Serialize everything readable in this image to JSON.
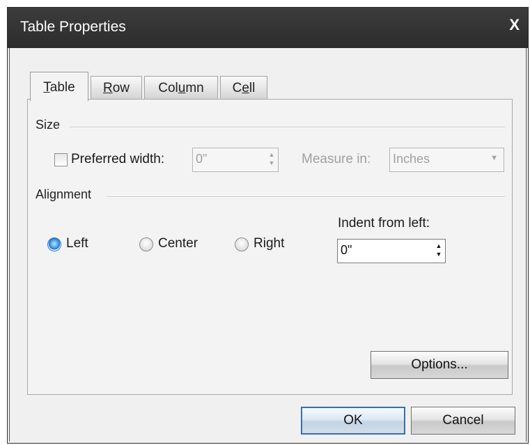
{
  "window": {
    "title": "Table Properties",
    "close_glyph": "X"
  },
  "tabs": [
    {
      "label": "Table",
      "mnemonic": "T",
      "rest": "able"
    },
    {
      "label": "Row",
      "mnemonic": "R",
      "rest": "ow"
    },
    {
      "label": "Column",
      "pre": "Col",
      "mnemonic": "u",
      "rest": "mn"
    },
    {
      "label": "Cell",
      "pre": "C",
      "mnemonic": "e",
      "rest": "ll"
    }
  ],
  "size": {
    "group_label": "Size",
    "preferred_width_label": "Preferred width:",
    "preferred_width_value": "0\"",
    "preferred_width_checked": false,
    "measure_in_label": "Measure in:",
    "measure_in_value": "Inches"
  },
  "alignment": {
    "group_label": "Alignment",
    "options": [
      "Left",
      "Center",
      "Right"
    ],
    "selected": "Left",
    "indent_label": "Indent from left:",
    "indent_value": "0\""
  },
  "buttons": {
    "options": "Options...",
    "ok": "OK",
    "cancel": "Cancel"
  },
  "colors": {
    "title_bar": "#333333",
    "selected_radio": "#3d9be8",
    "dialog_bg": "#f0f0f0"
  }
}
